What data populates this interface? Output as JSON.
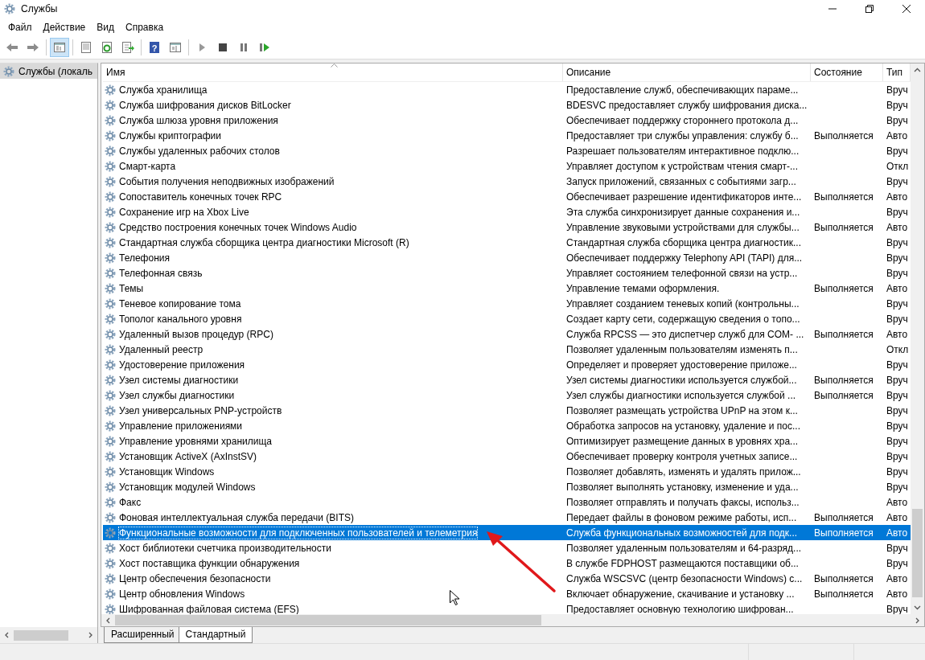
{
  "window": {
    "title": "Службы"
  },
  "menu": [
    "Файл",
    "Действие",
    "Вид",
    "Справка"
  ],
  "toolbar": [
    [
      {
        "kind": "back",
        "on": false
      },
      {
        "kind": "forward",
        "on": false
      }
    ],
    [
      {
        "kind": "tree",
        "on": true
      }
    ],
    [
      {
        "kind": "props",
        "on": false
      },
      {
        "kind": "refresh",
        "on": false
      },
      {
        "kind": "export",
        "on": false
      }
    ],
    [
      {
        "kind": "help",
        "on": false,
        "glyph": "?"
      },
      {
        "kind": "view",
        "on": false
      }
    ],
    [
      {
        "kind": "play",
        "on": false
      },
      {
        "kind": "stop",
        "on": false
      },
      {
        "kind": "pause",
        "on": false
      },
      {
        "kind": "resume",
        "on": false
      }
    ]
  ],
  "tree": {
    "items": [
      {
        "label": "Службы (локаль",
        "selected": true
      }
    ]
  },
  "table": {
    "columns": [
      "Имя",
      "Описание",
      "Состояние",
      "Тип"
    ],
    "rows": [
      {
        "name": "Служба хранилища",
        "description": "Предоставление служб, обеспечивающих параме...",
        "startup": "Вруч",
        "selected": false
      },
      {
        "name": "Служба шифрования дисков BitLocker",
        "description": "BDESVC предоставляет службу шифрования диска...",
        "startup": "Вруч",
        "selected": false
      },
      {
        "name": "Служба шлюза уровня приложения",
        "description": "Обеспечивает поддержку стороннего протокола д...",
        "startup": "Вруч",
        "selected": false
      },
      {
        "name": "Службы криптографии",
        "description": "Предоставляет три службы управления: службу б...",
        "status": "Выполняется",
        "startup": "Авто",
        "selected": false
      },
      {
        "name": "Службы удаленных рабочих столов",
        "description": "Разрешает пользователям интерактивное подклю...",
        "startup": "Вруч",
        "selected": false
      },
      {
        "name": "Смарт-карта",
        "description": "Управляет доступом к устройствам чтения смарт-...",
        "startup": "Откл",
        "selected": false
      },
      {
        "name": "События получения неподвижных изображений",
        "description": "Запуск приложений, связанных с событиями загр...",
        "startup": "Вруч",
        "selected": false
      },
      {
        "name": "Сопоставитель конечных точек RPC",
        "description": "Обеспечивает разрешение идентификаторов инте...",
        "status": "Выполняется",
        "startup": "Авто",
        "selected": false
      },
      {
        "name": "Сохранение игр на Xbox Live",
        "description": "Эта служба синхронизирует данные сохранения и...",
        "startup": "Вруч",
        "selected": false
      },
      {
        "name": "Средство построения конечных точек Windows Audio",
        "description": "Управление звуковыми устройствами для службы...",
        "status": "Выполняется",
        "startup": "Авто",
        "selected": false
      },
      {
        "name": "Стандартная служба сборщика центра диагностики Microsoft (R)",
        "description": "Стандартная служба сборщика центра диагностик...",
        "startup": "Вруч",
        "selected": false
      },
      {
        "name": "Телефония",
        "description": "Обеспечивает поддержку Telephony API (TAPI) для...",
        "startup": "Вруч",
        "selected": false
      },
      {
        "name": "Телефонная связь",
        "description": "Управляет состоянием телефонной связи на устр...",
        "startup": "Вруч",
        "selected": false
      },
      {
        "name": "Темы",
        "description": "Управление темами оформления.",
        "status": "Выполняется",
        "startup": "Авто",
        "selected": false
      },
      {
        "name": "Теневое копирование тома",
        "description": "Управляет созданием теневых копий (контрольны...",
        "startup": "Вруч",
        "selected": false
      },
      {
        "name": "Тополог канального уровня",
        "description": "Создает карту сети, содержащую сведения о топо...",
        "startup": "Вруч",
        "selected": false
      },
      {
        "name": "Удаленный вызов процедур (RPC)",
        "description": "Служба RPCSS — это диспетчер служб для COM- ...",
        "status": "Выполняется",
        "startup": "Авто",
        "selected": false
      },
      {
        "name": "Удаленный реестр",
        "description": "Позволяет удаленным пользователям изменять п...",
        "startup": "Откл",
        "selected": false
      },
      {
        "name": "Удостоверение приложения",
        "description": "Определяет и проверяет удостоверение приложе...",
        "startup": "Вруч",
        "selected": false
      },
      {
        "name": "Узел системы диагностики",
        "description": "Узел системы диагностики используется службой...",
        "status": "Выполняется",
        "startup": "Вруч",
        "selected": false
      },
      {
        "name": "Узел службы диагностики",
        "description": "Узел службы диагностики используется службой ...",
        "status": "Выполняется",
        "startup": "Вруч",
        "selected": false
      },
      {
        "name": "Узел универсальных PNP-устройств",
        "description": "Позволяет размещать устройства UPnP на этом к...",
        "startup": "Вруч",
        "selected": false
      },
      {
        "name": "Управление приложениями",
        "description": "Обработка запросов на установку, удаление и пос...",
        "startup": "Вруч",
        "selected": false
      },
      {
        "name": "Управление уровнями хранилища",
        "description": "Оптимизирует размещение данных в уровнях хра...",
        "startup": "Вруч",
        "selected": false
      },
      {
        "name": "Установщик ActiveX (AxInstSV)",
        "description": "Обеспечивает проверку контроля учетных записе...",
        "startup": "Вруч",
        "selected": false
      },
      {
        "name": "Установщик Windows",
        "description": "Позволяет добавлять, изменять и удалять прилож...",
        "startup": "Вруч",
        "selected": false
      },
      {
        "name": "Установщик модулей Windows",
        "description": "Позволяет выполнять установку, изменение и уда...",
        "startup": "Вруч",
        "selected": false
      },
      {
        "name": "Факс",
        "description": "Позволяет отправлять и получать факсы, использ...",
        "startup": "Авто",
        "selected": false
      },
      {
        "name": "Фоновая интеллектуальная служба передачи (BITS)",
        "description": "Передает файлы в фоновом режиме работы, исп...",
        "status": "Выполняется",
        "startup": "Авто",
        "selected": false
      },
      {
        "name": "Функциональные возможности для подключенных пользователей и телеметрия",
        "description": "Служба функциональных возможностей для подк...",
        "status": "Выполняется",
        "startup": "Авто",
        "selected": true
      },
      {
        "name": "Хост библиотеки счетчика производительности",
        "description": "Позволяет удаленным пользователям и 64-разряд...",
        "startup": "Вруч",
        "selected": false
      },
      {
        "name": "Хост поставщика функции обнаружения",
        "description": "В службе FDPHOST размещаются поставщики об...",
        "startup": "Вруч",
        "selected": false
      },
      {
        "name": "Центр обеспечения безопасности",
        "description": "Служба WSCSVC (центр безопасности Windows) с...",
        "status": "Выполняется",
        "startup": "Авто",
        "selected": false
      },
      {
        "name": "Центр обновления Windows",
        "description": "Включает обнаружение, скачивание и установку ...",
        "status": "Выполняется",
        "startup": "Авто",
        "selected": false
      },
      {
        "name": "Шифрованная файловая система (EFS)",
        "description": "Предоставляет основную технологию шифрован...",
        "startup": "Вруч",
        "selected": false
      }
    ]
  },
  "view_tabs": [
    {
      "label": "Расширенный",
      "selected": false
    },
    {
      "label": "Стандартный",
      "selected": true
    }
  ]
}
